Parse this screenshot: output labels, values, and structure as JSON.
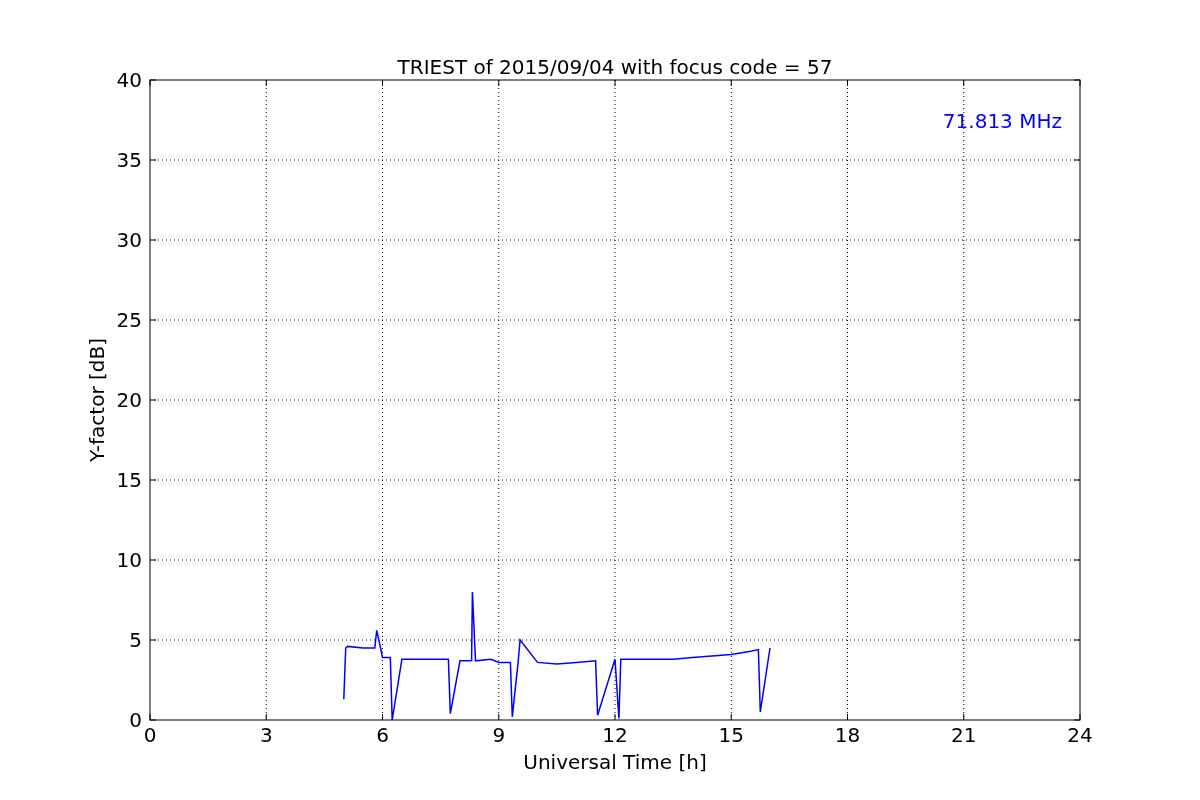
{
  "chart_data": {
    "type": "line",
    "title": "TRIEST of 2015/09/04 with focus code = 57",
    "xlabel": "Universal Time [h]",
    "ylabel": "Y-factor [dB]",
    "xlim": [
      0,
      24
    ],
    "ylim": [
      0,
      40
    ],
    "xticks": [
      0,
      3,
      6,
      9,
      12,
      15,
      18,
      21,
      24
    ],
    "yticks": [
      0,
      5,
      10,
      15,
      20,
      25,
      30,
      35,
      40
    ],
    "x": [
      5.0,
      5.05,
      5.1,
      5.5,
      5.8,
      5.85,
      5.95,
      6.0,
      6.2,
      6.25,
      6.5,
      7.0,
      7.7,
      7.75,
      8.0,
      8.3,
      8.32,
      8.4,
      8.8,
      9.0,
      9.3,
      9.35,
      9.5,
      9.55,
      10.0,
      10.5,
      11.0,
      11.5,
      11.55,
      12.0,
      12.1,
      12.15,
      12.5,
      13.0,
      13.5,
      14.0,
      14.5,
      15.0,
      15.5,
      15.7,
      15.75,
      16.0
    ],
    "series": [
      {
        "name": "71.813 MHz",
        "color": "#0000ff",
        "values": [
          1.3,
          4.5,
          4.6,
          4.5,
          4.5,
          5.6,
          4.5,
          3.9,
          3.9,
          0.0,
          3.8,
          3.8,
          3.8,
          0.4,
          3.7,
          3.7,
          8.0,
          3.7,
          3.8,
          3.6,
          3.6,
          0.2,
          3.6,
          5.0,
          3.6,
          3.5,
          3.6,
          3.7,
          0.3,
          3.8,
          0.1,
          3.8,
          3.8,
          3.8,
          3.8,
          3.9,
          4.0,
          4.1,
          4.3,
          4.4,
          0.5,
          4.5
        ]
      }
    ],
    "grid": true
  }
}
